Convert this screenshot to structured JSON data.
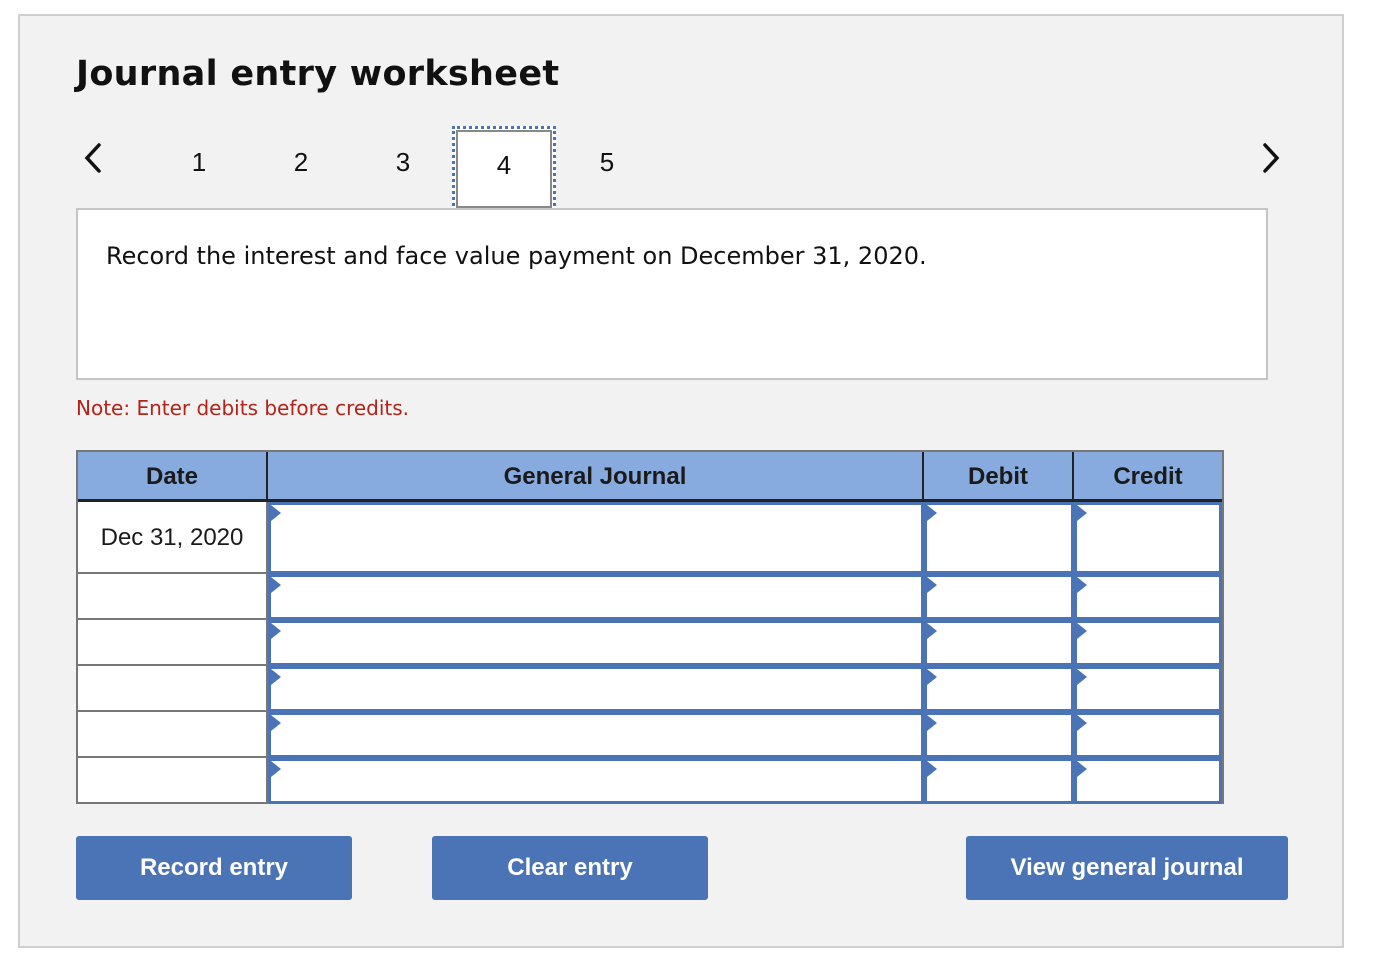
{
  "worksheet": {
    "title": "Journal entry worksheet",
    "nav": {
      "prev_icon": "chevron-left-icon",
      "next_icon": "chevron-right-icon",
      "tabs": [
        {
          "label": "1",
          "active": false
        },
        {
          "label": "2",
          "active": false
        },
        {
          "label": "3",
          "active": false
        },
        {
          "label": "4",
          "active": true
        },
        {
          "label": "5",
          "active": false
        }
      ]
    },
    "description": "Record the interest and face value payment on December 31, 2020.",
    "note": "Note: Enter debits before credits.",
    "table": {
      "headers": {
        "date": "Date",
        "journal": "General Journal",
        "debit": "Debit",
        "credit": "Credit"
      },
      "rows": [
        {
          "date": "Dec 31, 2020",
          "account": "",
          "debit": "",
          "credit": ""
        },
        {
          "date": "",
          "account": "",
          "debit": "",
          "credit": ""
        },
        {
          "date": "",
          "account": "",
          "debit": "",
          "credit": ""
        },
        {
          "date": "",
          "account": "",
          "debit": "",
          "credit": ""
        },
        {
          "date": "",
          "account": "",
          "debit": "",
          "credit": ""
        },
        {
          "date": "",
          "account": "",
          "debit": "",
          "credit": ""
        }
      ]
    },
    "buttons": {
      "record": "Record entry",
      "clear": "Clear entry",
      "view": "View general journal"
    }
  }
}
